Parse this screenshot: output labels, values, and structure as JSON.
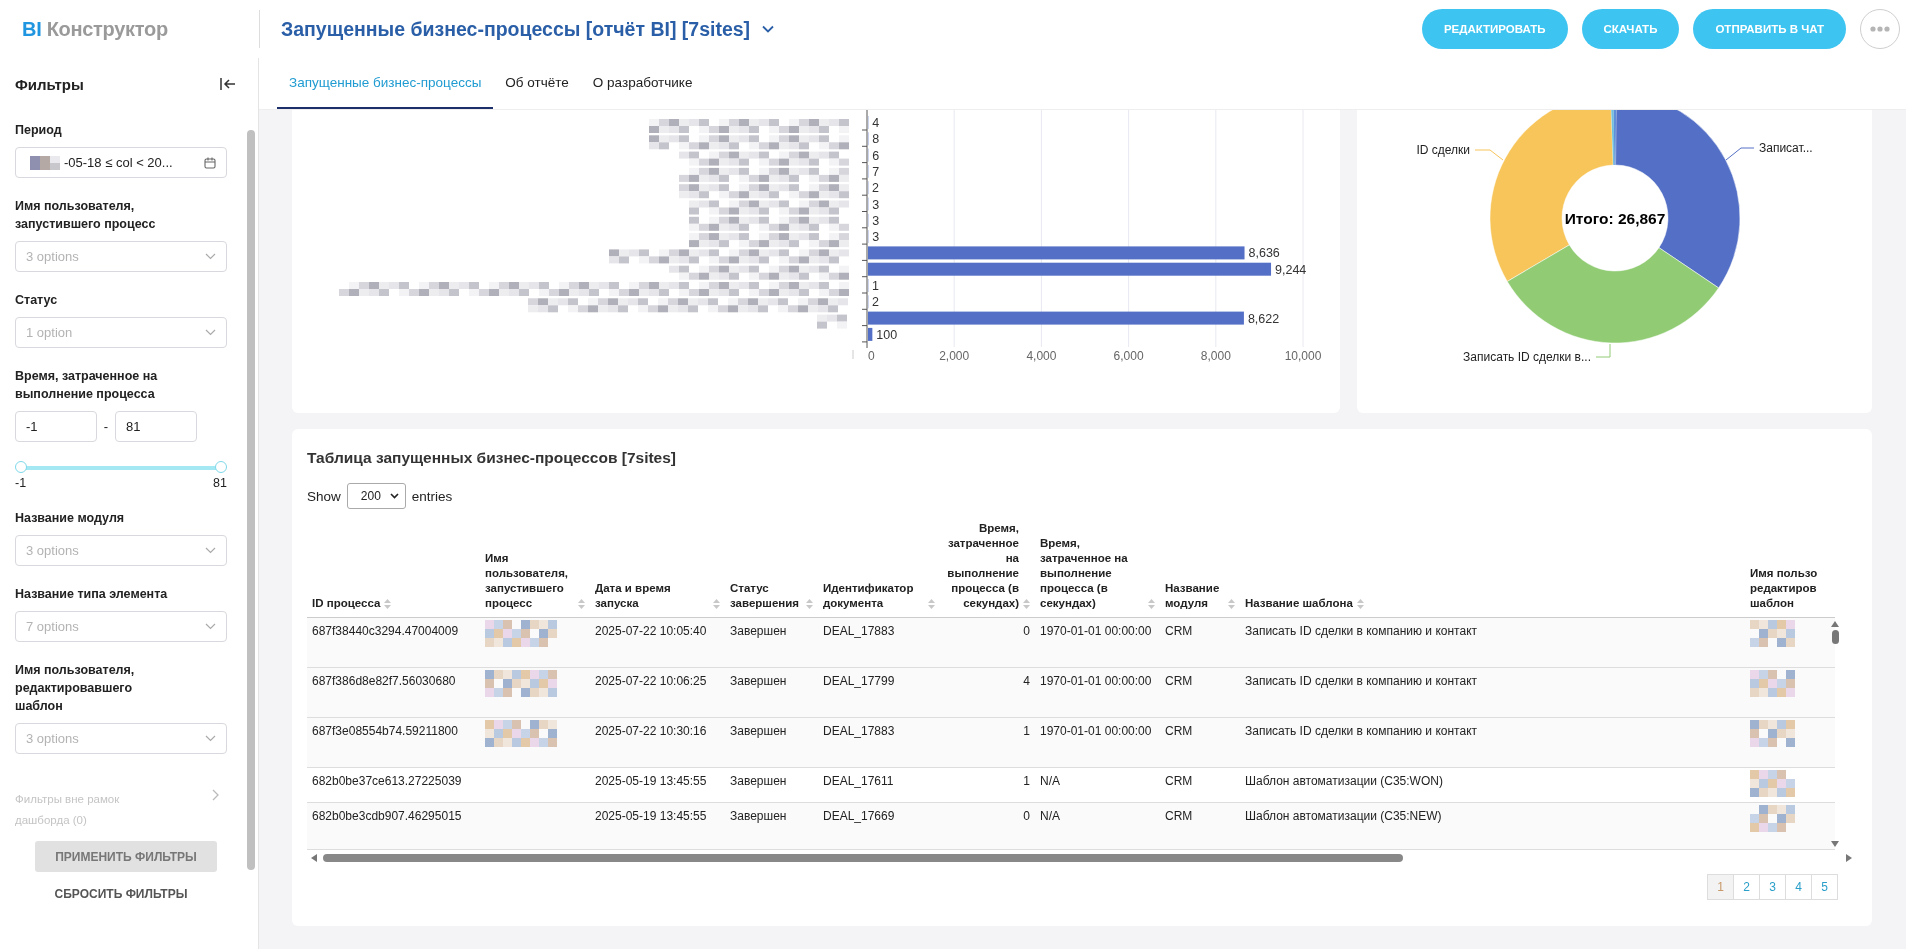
{
  "header": {
    "logo_bi": "BI",
    "logo_text": "Конструктор",
    "title": "Запущенные бизнес-процессы [отчёт BI] [7sites]",
    "buttons": [
      "РЕДАКТИРОВАТЬ",
      "СКАЧАТЬ",
      "ОТПРАВИТЬ В ЧАТ"
    ]
  },
  "tabs": [
    {
      "label": "Запущенные бизнес-процессы",
      "selected": true
    },
    {
      "label": "Об отчёте",
      "selected": false
    },
    {
      "label": "О разработчике",
      "selected": false
    }
  ],
  "sidebar": {
    "title": "Фильтры",
    "filters": [
      {
        "kind": "date",
        "label": "Период",
        "value": "-05-18 ≤ col < 20..."
      },
      {
        "kind": "select",
        "label": "Имя пользователя, запустившего процесс",
        "placeholder": "3 options"
      },
      {
        "kind": "select",
        "label": "Статус",
        "placeholder": "1 option"
      },
      {
        "kind": "range",
        "label": "Время, затраченное на выполнение процесса",
        "from": "-1",
        "to": "81",
        "separator": "-",
        "min_label": "-1",
        "max_label": "81",
        "thumbs": [
          {
            "level": 0
          },
          {
            "level": 1
          }
        ]
      },
      {
        "kind": "select",
        "label": "Название модуля",
        "placeholder": "3 options"
      },
      {
        "kind": "select",
        "label": "Название типа элемента",
        "placeholder": "7 options"
      },
      {
        "kind": "select",
        "label": "Имя пользователя, редактировавшего шаблон",
        "placeholder": "3 options"
      }
    ],
    "outside": {
      "text": "Фильтры вне рамок дашборда (0)",
      "disabled": true
    },
    "apply_button": {
      "label": "ПРИМЕНИТЬ ФИЛЬТРЫ",
      "disabled": true
    },
    "reset_button": "СБРОСИТЬ ФИЛЬТРЫ"
  },
  "bar_chart": {
    "chart_data": {
      "type": "bar",
      "orientation": "horizontal",
      "values": [
        4,
        8,
        6,
        7,
        2,
        3,
        3,
        3,
        8636,
        9244,
        1,
        2,
        8622,
        100
      ],
      "value_labels": [
        "4",
        "8",
        "6",
        "7",
        "2",
        "3",
        "3",
        "3",
        "8,636",
        "9,244",
        "1",
        "2",
        "8,622",
        "100"
      ],
      "xlim": [
        0,
        10000
      ],
      "grid": true,
      "xticks": [
        {
          "value": 0,
          "label": "0"
        },
        {
          "value": 2000,
          "label": "2,000"
        },
        {
          "value": 4000,
          "label": "4,000"
        },
        {
          "value": 6000,
          "label": "6,000"
        },
        {
          "value": 8000,
          "label": "8,000"
        },
        {
          "value": 10000,
          "label": "10,000"
        }
      ]
    }
  },
  "donut": {
    "total": "Итого: 26,867",
    "labels": [
      {
        "text": "ID сделки",
        "color": "#f7c55a"
      },
      {
        "text": "Записат...",
        "color": "#5470c6"
      },
      {
        "text": "Записать ID сделки в...",
        "color": "#91cc75"
      }
    ]
  },
  "table": {
    "title": "Таблица запущенных бизнес-процессов [7sites]",
    "show_label": "Show",
    "page_size": "200",
    "entries_label": "entries",
    "columns": [
      {
        "label": "ID процесса",
        "kind": "text"
      },
      {
        "label": "Имя пользователя, запустившего процесс",
        "kind": "text"
      },
      {
        "label": "Дата и время запуска",
        "kind": "text"
      },
      {
        "label": "Статус завершения",
        "kind": "text"
      },
      {
        "label": "Идентификатор документа",
        "kind": "text"
      },
      {
        "label": "Время, затраченное на выполнение процесса (в секундах)",
        "kind": "number"
      },
      {
        "label": "Время, затраченное на выполнение процесса (в секундах)",
        "kind": "text"
      },
      {
        "label": "Название модуля",
        "kind": "text"
      },
      {
        "label": "Название шаблона",
        "kind": "text"
      },
      {
        "label": "Имя пользо\nредактиров\nшаблон",
        "kind": "text"
      }
    ],
    "rows": [
      {
        "cells": [
          {
            "text": "687f38440c3294.47004009"
          },
          {
            "kind": "blurred"
          },
          {
            "text": "2025-07-22 10:05:40"
          },
          {
            "text": "Завершен"
          },
          {
            "text": "DEAL_17883"
          },
          {
            "text": "0"
          },
          {
            "text": "1970-01-01 00:00:00"
          },
          {
            "text": "CRM"
          },
          {
            "text": "Записать ID сделки в компанию и контакт"
          },
          {
            "kind": "blurred"
          }
        ]
      },
      {
        "cells": [
          {
            "text": "687f386d8e82f7.56030680"
          },
          {
            "kind": "blurred"
          },
          {
            "text": "2025-07-22 10:06:25"
          },
          {
            "text": "Завершен"
          },
          {
            "text": "DEAL_17799"
          },
          {
            "text": "4"
          },
          {
            "text": "1970-01-01 00:00:00"
          },
          {
            "text": "CRM"
          },
          {
            "text": "Записать ID сделки в компанию и контакт"
          },
          {
            "kind": "blurred"
          }
        ]
      },
      {
        "cells": [
          {
            "text": "687f3e08554b74.59211800"
          },
          {
            "kind": "blurred"
          },
          {
            "text": "2025-07-22 10:30:16"
          },
          {
            "text": "Завершен"
          },
          {
            "text": "DEAL_17883"
          },
          {
            "text": "1"
          },
          {
            "text": "1970-01-01 00:00:00"
          },
          {
            "text": "CRM"
          },
          {
            "text": "Записать ID сделки в компанию и контакт"
          },
          {
            "kind": "blurred"
          }
        ]
      },
      {
        "cells": [
          {
            "text": "682b0be37ce613.27225039"
          },
          {
            "kind": "empty"
          },
          {
            "text": "2025-05-19 13:45:55"
          },
          {
            "text": "Завершен"
          },
          {
            "text": "DEAL_17611"
          },
          {
            "text": "1"
          },
          {
            "text": "N/A"
          },
          {
            "text": "CRM"
          },
          {
            "text": "Шаблон автоматизации (C35:WON)"
          },
          {
            "kind": "blurred"
          }
        ]
      },
      {
        "cells": [
          {
            "text": "682b0be3cdb907.46295015"
          },
          {
            "kind": "empty"
          },
          {
            "text": "2025-05-19 13:45:55"
          },
          {
            "text": "Завершен"
          },
          {
            "text": "DEAL_17669"
          },
          {
            "text": "0"
          },
          {
            "text": "N/A"
          },
          {
            "text": "CRM"
          },
          {
            "text": "Шаблон автоматизации (C35:NEW)"
          },
          {
            "kind": "blurred"
          }
        ]
      }
    ],
    "pagination": [
      {
        "label": "1",
        "selected": true
      },
      {
        "label": "2",
        "selected": false
      },
      {
        "label": "3",
        "selected": false
      },
      {
        "label": "4",
        "selected": false
      },
      {
        "label": "5",
        "selected": false
      }
    ]
  }
}
